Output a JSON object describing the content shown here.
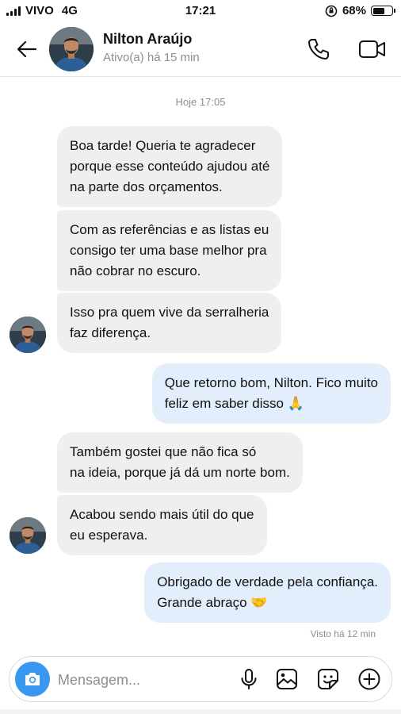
{
  "status_bar": {
    "carrier": "VIVO",
    "network": "4G",
    "time": "17:21",
    "battery_percent": "68%",
    "battery_level": 0.68
  },
  "header": {
    "contact_name": "Nilton Araújo",
    "contact_status": "Ativo(a) há 15 min"
  },
  "chat": {
    "date_divider": "Hoje 17:05",
    "messages": [
      {
        "direction": "in",
        "lines": [
          "Boa tarde! Queria te agradecer",
          "porque esse conteúdo ajudou até",
          "na parte dos orçamentos."
        ]
      },
      {
        "direction": "in",
        "lines": [
          "Com as referências e as listas eu",
          "consigo ter uma base melhor pra",
          "não cobrar no escuro."
        ]
      },
      {
        "direction": "in",
        "lines": [
          "Isso pra quem vive da serralheria",
          "faz diferença."
        ]
      },
      {
        "direction": "out",
        "lines": [
          "Que retorno bom, Nilton. Fico muito",
          "feliz em saber disso 🙏"
        ]
      },
      {
        "direction": "in",
        "lines": [
          "Também gostei que não fica só",
          "na ideia, porque já dá um norte bom."
        ]
      },
      {
        "direction": "in",
        "lines": [
          "Acabou sendo mais útil do que",
          "eu esperava."
        ]
      },
      {
        "direction": "out",
        "lines": [
          "Obrigado de verdade pela confiança.",
          "Grande abraço 🤝"
        ]
      }
    ],
    "seen_status": "Visto há 12 min"
  },
  "composer": {
    "placeholder": "Mensagem...",
    "icons": [
      "camera-icon",
      "microphone-icon",
      "gallery-icon",
      "sticker-icon",
      "plus-icon"
    ]
  },
  "colors": {
    "accent": "#3897f0",
    "incoming_bubble": "#efefef",
    "outgoing_bubble": "#e3eefc",
    "secondary_text": "#8e8e8e"
  }
}
